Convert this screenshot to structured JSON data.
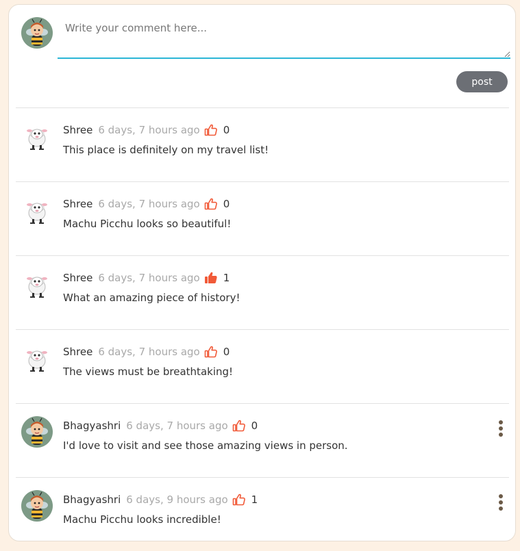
{
  "composer": {
    "placeholder": "Write your comment here...",
    "post_label": "post"
  },
  "colors": {
    "like": "#f15a38",
    "post_button": "#6c6f75",
    "textarea_underline": "#2bb6d6"
  },
  "comments": [
    {
      "author": "Shree",
      "time": "6 days, 7 hours ago",
      "likes": "0",
      "liked": false,
      "text": "This place is definitely on my travel list!",
      "avatar": "sheep-avatar",
      "menu": false
    },
    {
      "author": "Shree",
      "time": "6 days, 7 hours ago",
      "likes": "0",
      "liked": false,
      "text": "Machu Picchu looks so beautiful!",
      "avatar": "sheep-avatar",
      "menu": false
    },
    {
      "author": "Shree",
      "time": "6 days, 7 hours ago",
      "likes": "1",
      "liked": true,
      "text": "What an amazing piece of history!",
      "avatar": "sheep-avatar",
      "menu": false
    },
    {
      "author": "Shree",
      "time": "6 days, 7 hours ago",
      "likes": "0",
      "liked": false,
      "text": "The views must be breathtaking!",
      "avatar": "sheep-avatar",
      "menu": false
    },
    {
      "author": "Bhagyashri",
      "time": "6 days, 7 hours ago",
      "likes": "0",
      "liked": false,
      "text": "I'd love to visit and see those amazing views in person.",
      "avatar": "bee-avatar",
      "menu": true
    },
    {
      "author": "Bhagyashri",
      "time": "6 days, 9 hours ago",
      "likes": "1",
      "liked": false,
      "text": "Machu Picchu looks incredible!",
      "avatar": "bee-avatar",
      "menu": true
    }
  ]
}
